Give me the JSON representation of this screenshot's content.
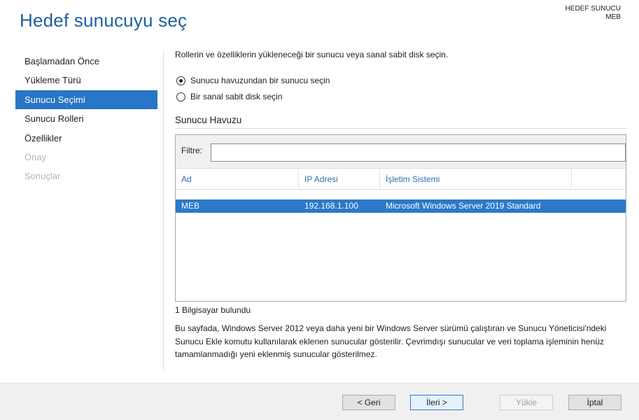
{
  "header": {
    "title": "Hedef sunucuyu seç",
    "destination_label": "HEDEF SUNUCU",
    "destination_value": "MEB"
  },
  "sidebar": {
    "items": [
      {
        "label": "Başlamadan Önce",
        "state": "normal"
      },
      {
        "label": "Yükleme Türü",
        "state": "normal"
      },
      {
        "label": "Sunucu Seçimi",
        "state": "active"
      },
      {
        "label": "Sunucu Rolleri",
        "state": "normal"
      },
      {
        "label": "Özellikler",
        "state": "normal"
      },
      {
        "label": "Onay",
        "state": "disabled"
      },
      {
        "label": "Sonuçlar",
        "state": "disabled"
      }
    ]
  },
  "main": {
    "intro": "Rollerin ve özelliklerin yükleneceği bir sunucu veya sanal sabit disk seçin.",
    "options": [
      {
        "label": "Sunucu havuzundan bir sunucu seçin",
        "checked": true
      },
      {
        "label": "Bir sanal sabit disk seçin",
        "checked": false
      }
    ],
    "pool_title": "Sunucu Havuzu",
    "filter_label": "Filtre:",
    "filter_value": "",
    "columns": [
      "Ad",
      "IP Adresi",
      "İşletim Sistemi"
    ],
    "rows": [
      {
        "name": "MEB",
        "ip": "192.168.1.100",
        "os": "Microsoft Windows Server 2019 Standard",
        "selected": true
      }
    ],
    "count_text": "1 Bilgisayar bulundu",
    "description": "Bu sayfada, Windows Server 2012 veya daha yeni bir Windows Server sürümü çalıştıran ve Sunucu Yöneticisi'ndeki Sunucu Ekle komutu kullanılarak eklenen sunucular gösterilir. Çevrimdışı sunucular ve veri toplama işleminin henüz tamamlanmadığı yeni eklenmiş sunucular gösterilmez."
  },
  "footer": {
    "back_label": "< Geri",
    "next_label": "İleri >",
    "install_label": "Yükle",
    "cancel_label": "İptal"
  },
  "colors": {
    "title": "#1f5f9e",
    "accent": "#2876c5",
    "column_header": "#2b6fb6",
    "disabled_text": "#b4b4b4",
    "footer_bg": "#f0f0f0"
  }
}
